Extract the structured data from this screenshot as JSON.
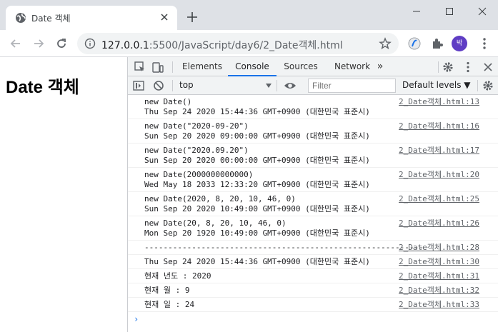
{
  "tab": {
    "title": "Date 객체"
  },
  "address_bar": {
    "host": "127.0.0.1",
    "path": ":5500/JavaScript/day6/2_Date객체.html"
  },
  "profile": {
    "initial": "박"
  },
  "page": {
    "heading": "Date 객체"
  },
  "devtools": {
    "tabs": [
      "Elements",
      "Console",
      "Sources",
      "Network"
    ],
    "more_tabs": "»",
    "context": "top",
    "filter_placeholder": "Filter",
    "levels": "Default levels ▼",
    "prompt": "›",
    "messages": [
      {
        "lines": [
          "new Date()",
          "Thu Sep 24 2020 15:44:36 GMT+0900 (대한민국 표준시)"
        ],
        "source": "2_Date객체.html:13"
      },
      {
        "lines": [
          "new Date(\"2020-09-20\")",
          "Sun Sep 20 2020 09:00:00 GMT+0900 (대한민국 표준시)"
        ],
        "source": "2_Date객체.html:16"
      },
      {
        "lines": [
          "new Date(\"2020.09.20\")",
          "Sun Sep 20 2020 00:00:00 GMT+0900 (대한민국 표준시)"
        ],
        "source": "2_Date객체.html:17"
      },
      {
        "lines": [
          "new Date(2000000000000)",
          "Wed May 18 2033 12:33:20 GMT+0900 (대한민국 표준시)"
        ],
        "source": "2_Date객체.html:20"
      },
      {
        "lines": [
          "new Date(2020, 8, 20, 10, 46, 0)",
          "Sun Sep 20 2020 10:49:00 GMT+0900 (대한민국 표준시)"
        ],
        "source": "2_Date객체.html:25"
      },
      {
        "lines": [
          "new Date(20, 8, 20, 10, 46, 0)",
          "Mon Sep 20 1920 10:49:00 GMT+0900 (대한민국 표준시)"
        ],
        "source": "2_Date객체.html:26"
      },
      {
        "lines": [
          "-----------------------------------------------------------"
        ],
        "source": "2_Date객체.html:28"
      },
      {
        "lines": [
          "Thu Sep 24 2020 15:44:36 GMT+0900 (대한민국 표준시)"
        ],
        "source": "2_Date객체.html:30"
      },
      {
        "lines": [
          "현재 년도 : 2020"
        ],
        "source": "2_Date객체.html:31"
      },
      {
        "lines": [
          "현재 월 : 9"
        ],
        "source": "2_Date객체.html:32"
      },
      {
        "lines": [
          "현재 일 : 24"
        ],
        "source": "2_Date객체.html:33"
      }
    ]
  },
  "colors": {
    "accent": "#1a73e8",
    "chrome": "#dee1e6",
    "avatar": "#5f3dc4"
  }
}
